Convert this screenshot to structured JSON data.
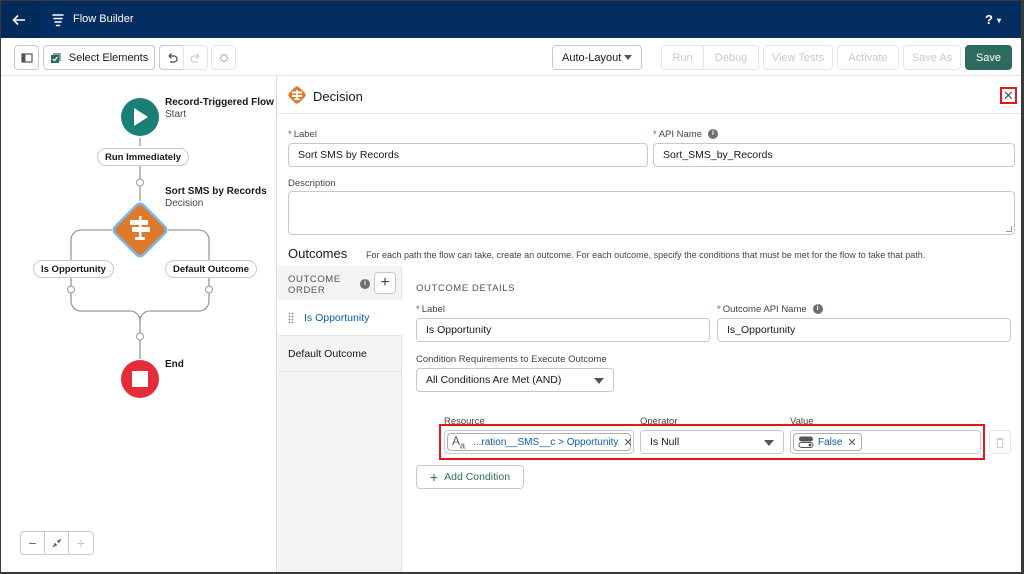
{
  "header": {
    "back_icon": "arrow-left-icon",
    "app_icon": "flow-icon",
    "title": "Flow Builder",
    "help_label": "?",
    "help_caret": "▾"
  },
  "toolbar": {
    "toggle_panel_icon": "panel-toggle-icon",
    "select_elements_label": "Select Elements",
    "undo_icon": "undo-icon",
    "redo_icon": "redo-icon",
    "settings_icon": "gear-icon",
    "layout_select": "Auto-Layout",
    "run_label": "Run",
    "debug_label": "Debug",
    "view_tests_label": "View Tests",
    "activate_label": "Activate",
    "save_as_label": "Save As",
    "save_label": "Save",
    "save_color": "#2e6b5e"
  },
  "canvas": {
    "start_node": {
      "title": "Record-Triggered Flow",
      "subtitle": "Start",
      "color": "#1a7f74"
    },
    "run_pill": "Run Immediately",
    "decision_node": {
      "title": "Sort SMS by Records",
      "subtitle": "Decision",
      "color": "#dd7a2b"
    },
    "outcome_pills": [
      "Is Opportunity",
      "Default Outcome"
    ],
    "end_node": {
      "title": "End",
      "color": "#e52d3a"
    },
    "zoom_controls": {
      "zoom_out": "−",
      "fit": "fit-view-icon",
      "zoom_in": "+"
    }
  },
  "panel": {
    "title": "Decision",
    "close_label": "✕",
    "label_field": {
      "label": "Label",
      "value": "Sort SMS by Records"
    },
    "api_name_field": {
      "label": "API Name",
      "value": "Sort_SMS_by_Records"
    },
    "description_field": {
      "label": "Description",
      "value": ""
    },
    "outcomes": {
      "title": "Outcomes",
      "description": "For each path the flow can take, create an outcome. For each outcome, specify the conditions that must be met for the flow to take that path.",
      "order_header": "OUTCOME ORDER",
      "order_items": [
        "Is Opportunity",
        "Default Outcome"
      ],
      "details_header": "OUTCOME DETAILS",
      "label_field": {
        "label": "Label",
        "value": "Is Opportunity"
      },
      "api_name_field": {
        "label": "Outcome API Name",
        "value": "Is_Opportunity"
      },
      "condition_req": {
        "label": "Condition Requirements to Execute Outcome",
        "value": "All Conditions Are Met (AND)"
      },
      "condition": {
        "resource_label": "Resource",
        "resource_value": "...ration__SMS__c > Opportunity",
        "operator_label": "Operator",
        "operator_value": "Is Null",
        "value_label": "Value",
        "value_value": "False"
      },
      "add_condition_label": "Add Condition"
    }
  }
}
